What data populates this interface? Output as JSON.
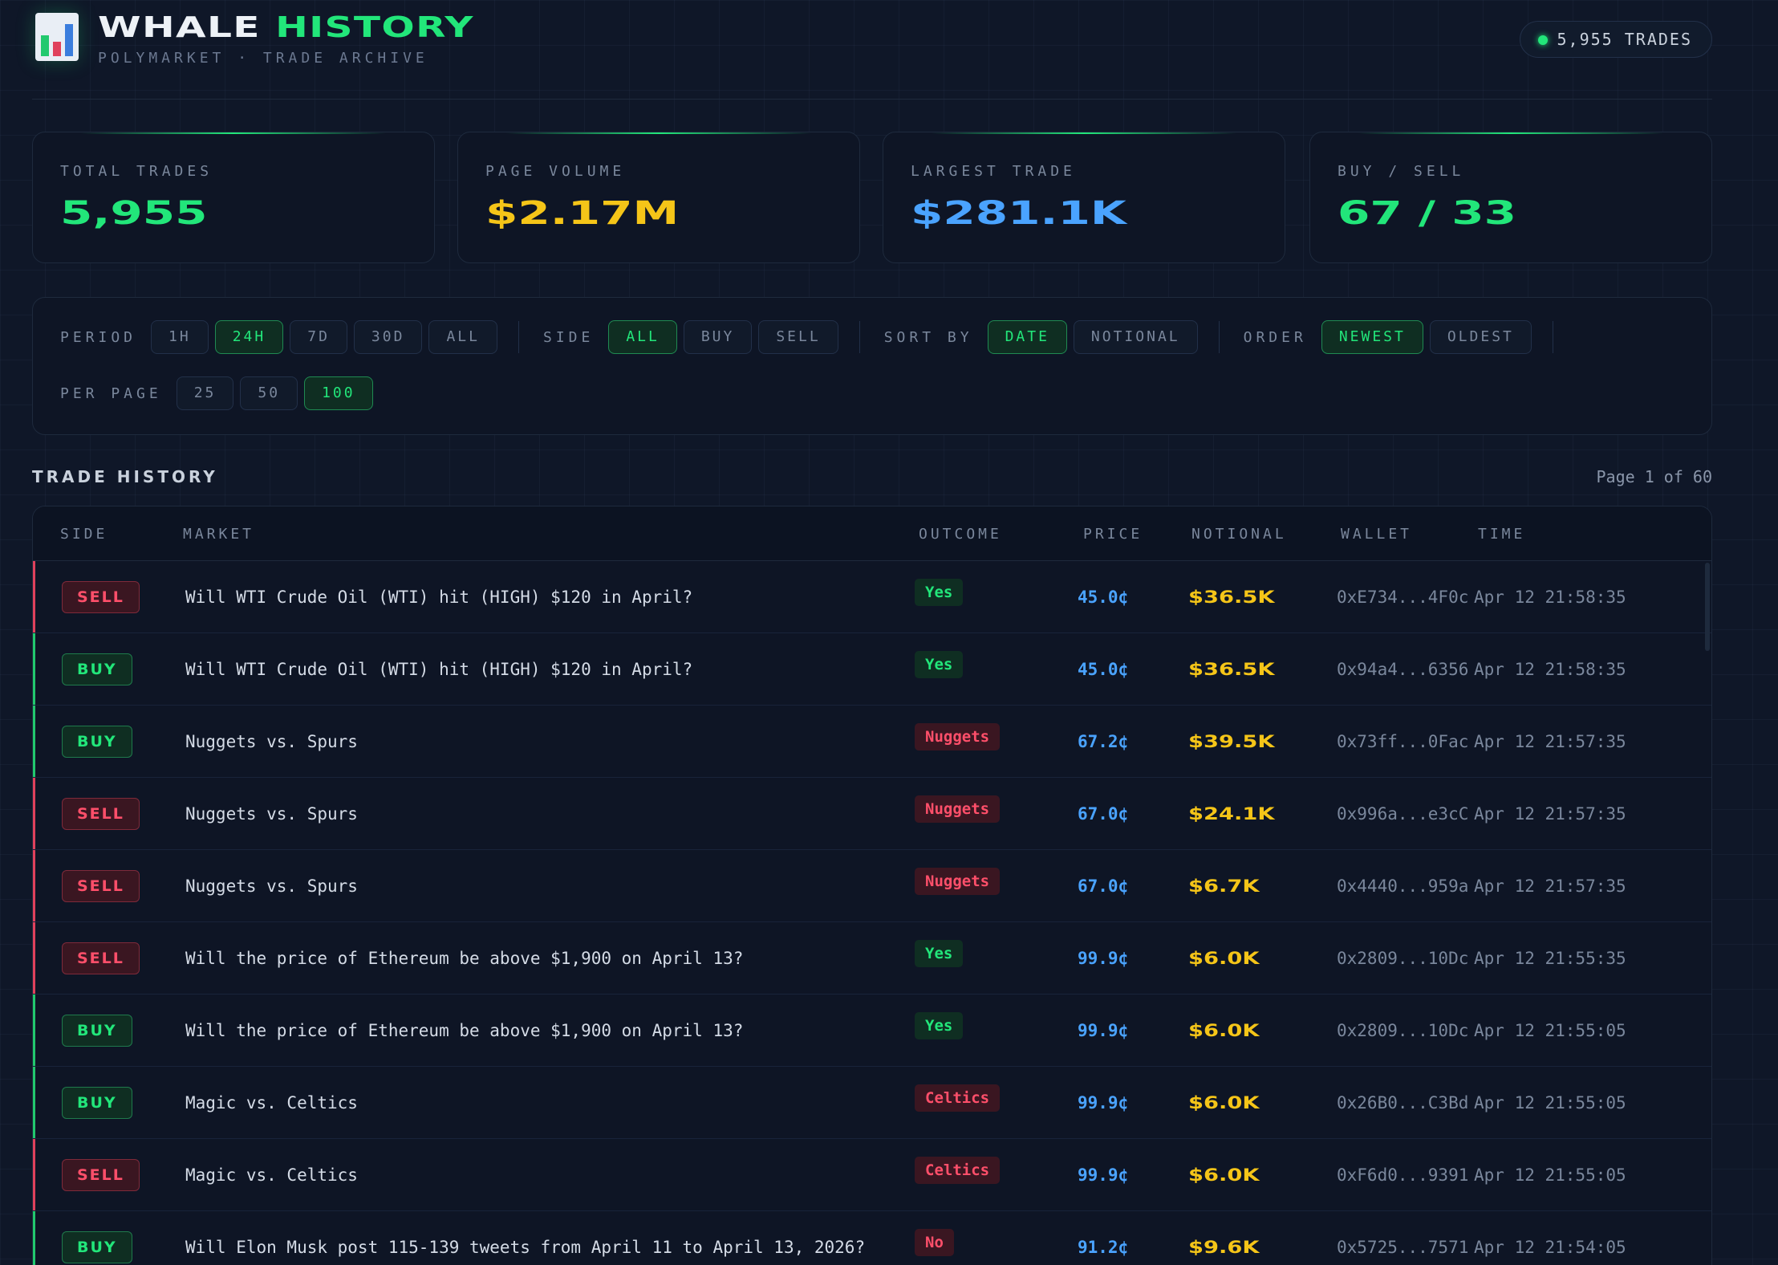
{
  "header": {
    "title_part1": "WHALE",
    "title_part2": "HISTORY",
    "subtitle": "POLYMARKET · TRADE ARCHIVE",
    "trades_pill": "5,955 TRADES"
  },
  "stats": [
    {
      "label": "TOTAL TRADES",
      "value": "5,955",
      "color": "#22e67a"
    },
    {
      "label": "PAGE VOLUME",
      "value": "$2.17M",
      "color": "#f5c518"
    },
    {
      "label": "LARGEST TRADE",
      "value": "$281.1K",
      "color": "#4aa3ff"
    },
    {
      "label": "BUY / SELL",
      "value": "67 / 33",
      "color": "#22e67a"
    }
  ],
  "filters": {
    "period": {
      "label": "PERIOD",
      "options": [
        "1H",
        "24H",
        "7D",
        "30D",
        "ALL"
      ],
      "active": "24H"
    },
    "side": {
      "label": "SIDE",
      "options": [
        "ALL",
        "BUY",
        "SELL"
      ],
      "active": "ALL"
    },
    "sort": {
      "label": "SORT BY",
      "options": [
        "DATE",
        "NOTIONAL"
      ],
      "active": "DATE"
    },
    "order": {
      "label": "ORDER",
      "options": [
        "NEWEST",
        "OLDEST"
      ],
      "active": "NEWEST"
    },
    "per_page": {
      "label": "PER PAGE",
      "options": [
        "25",
        "50",
        "100"
      ],
      "active": "100"
    }
  },
  "table": {
    "title": "TRADE HISTORY",
    "pager": "Page 1 of 60",
    "columns": {
      "side": "SIDE",
      "market": "MARKET",
      "outcome": "OUTCOME",
      "price": "PRICE",
      "notional": "NOTIONAL",
      "wallet": "WALLET",
      "time": "TIME"
    },
    "rows": [
      {
        "side": "SELL",
        "market": "Will WTI Crude Oil (WTI) hit (HIGH) $120 in April?",
        "outcome": "Yes",
        "outcome_type": "yes",
        "price": "45.0¢",
        "notional": "$36.5K",
        "wallet": "0xE734...4F0c",
        "time": "Apr 12 21:58:35"
      },
      {
        "side": "BUY",
        "market": "Will WTI Crude Oil (WTI) hit (HIGH) $120 in April?",
        "outcome": "Yes",
        "outcome_type": "yes",
        "price": "45.0¢",
        "notional": "$36.5K",
        "wallet": "0x94a4...6356",
        "time": "Apr 12 21:58:35"
      },
      {
        "side": "BUY",
        "market": "Nuggets vs. Spurs",
        "outcome": "Nuggets",
        "outcome_type": "no",
        "price": "67.2¢",
        "notional": "$39.5K",
        "wallet": "0x73ff...0Fac",
        "time": "Apr 12 21:57:35"
      },
      {
        "side": "SELL",
        "market": "Nuggets vs. Spurs",
        "outcome": "Nuggets",
        "outcome_type": "no",
        "price": "67.0¢",
        "notional": "$24.1K",
        "wallet": "0x996a...e3cC",
        "time": "Apr 12 21:57:35"
      },
      {
        "side": "SELL",
        "market": "Nuggets vs. Spurs",
        "outcome": "Nuggets",
        "outcome_type": "no",
        "price": "67.0¢",
        "notional": "$6.7K",
        "wallet": "0x4440...959a",
        "time": "Apr 12 21:57:35"
      },
      {
        "side": "SELL",
        "market": "Will the price of Ethereum be above $1,900 on April 13?",
        "outcome": "Yes",
        "outcome_type": "yes",
        "price": "99.9¢",
        "notional": "$6.0K",
        "wallet": "0x2809...10Dc",
        "time": "Apr 12 21:55:35"
      },
      {
        "side": "BUY",
        "market": "Will the price of Ethereum be above $1,900 on April 13?",
        "outcome": "Yes",
        "outcome_type": "yes",
        "price": "99.9¢",
        "notional": "$6.0K",
        "wallet": "0x2809...10Dc",
        "time": "Apr 12 21:55:05"
      },
      {
        "side": "BUY",
        "market": "Magic vs. Celtics",
        "outcome": "Celtics",
        "outcome_type": "no",
        "price": "99.9¢",
        "notional": "$6.0K",
        "wallet": "0x26B0...C3Bd",
        "time": "Apr 12 21:55:05"
      },
      {
        "side": "SELL",
        "market": "Magic vs. Celtics",
        "outcome": "Celtics",
        "outcome_type": "no",
        "price": "99.9¢",
        "notional": "$6.0K",
        "wallet": "0xF6d0...9391",
        "time": "Apr 12 21:55:05"
      },
      {
        "side": "BUY",
        "market": "Will Elon Musk post 115-139 tweets from April 11 to April 13, 2026?",
        "outcome": "No",
        "outcome_type": "no",
        "price": "91.2¢",
        "notional": "$9.6K",
        "wallet": "0x5725...7571",
        "time": "Apr 12 21:54:05"
      }
    ]
  }
}
